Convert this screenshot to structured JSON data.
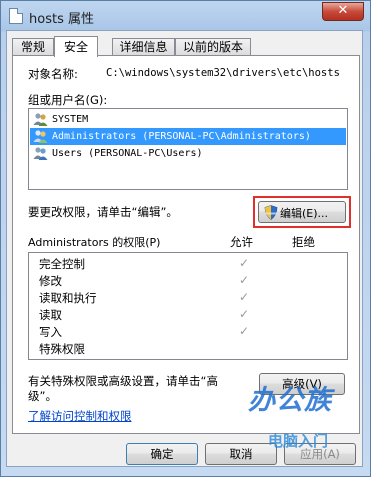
{
  "window": {
    "title": "hosts 属性",
    "close_glyph": "✕"
  },
  "tabs": [
    {
      "label": "常规",
      "active": false
    },
    {
      "label": "安全",
      "active": true
    },
    {
      "label": "详细信息",
      "active": false
    },
    {
      "label": "以前的版本",
      "active": false
    }
  ],
  "object_label": "对象名称:",
  "object_path": "C:\\windows\\system32\\drivers\\etc\\hosts",
  "group_label": "组或用户名(G):",
  "users": [
    {
      "name": "SYSTEM",
      "selected": false,
      "icon": "users-icon"
    },
    {
      "name": "Administrators (PERSONAL-PC\\Administrators)",
      "selected": true,
      "icon": "users-icon"
    },
    {
      "name": "Users (PERSONAL-PC\\Users)",
      "selected": false,
      "icon": "users-icon"
    }
  ],
  "edit_hint": "要更改权限，请单击“编辑”。",
  "edit_button": "编辑(E)...",
  "perm_header": {
    "title": "Administrators 的权限(P)",
    "allow": "允许",
    "deny": "拒绝"
  },
  "permissions": [
    {
      "name": "完全控制",
      "allow": true
    },
    {
      "name": "修改",
      "allow": true
    },
    {
      "name": "读取和执行",
      "allow": true
    },
    {
      "name": "读取",
      "allow": true
    },
    {
      "name": "写入",
      "allow": true
    },
    {
      "name": "特殊权限",
      "allow": false
    }
  ],
  "check_glyph": "✓",
  "advanced_hint_line1": "有关特殊权限或高级设置，请单击“高",
  "advanced_hint_line2": "级”。",
  "advanced_button": "高级(V)",
  "learn_link": "了解访问控制和权限",
  "footer": {
    "ok": "确定",
    "cancel": "取消",
    "apply": "应用(A)"
  },
  "watermark": {
    "line1": "办公族",
    "line2": "电脑入门"
  },
  "colors": {
    "selection": "#3399ff",
    "highlight_border": "#e0302b",
    "link": "#0044cc"
  }
}
